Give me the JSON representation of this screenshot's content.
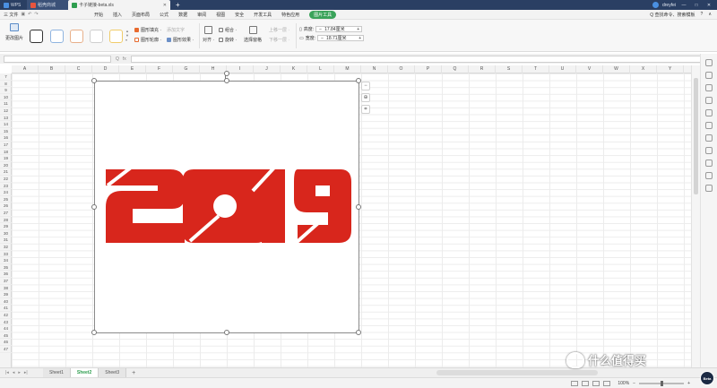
{
  "titlebar": {
    "tabs": [
      {
        "label": "WPS",
        "icon": "wps-logo-icon"
      },
      {
        "label": "稻壳商城",
        "icon": "docer-icon"
      },
      {
        "label": "卡子链接-beta.xls",
        "icon": "spreadsheet-icon",
        "active": true
      }
    ],
    "user": "dreyfei",
    "buttons": [
      "—",
      "□",
      "✕"
    ]
  },
  "menu": {
    "file_label": "三 文件",
    "items": [
      "开始",
      "插入",
      "页面布局",
      "公式",
      "数据",
      "审阅",
      "视图",
      "安全",
      "开发工具",
      "特色应用",
      "图片工具"
    ],
    "active_item": "图片工具",
    "search_label": "Q 查找命令、搜索模板"
  },
  "ribbon": {
    "change_picture": "更改图片",
    "effects": [
      "图形填充 ·",
      "图形轮廓 ·"
    ],
    "effects_right": [
      "添加文字",
      "图形效果 ·"
    ],
    "arrange_col1": [
      "对齐 ·",
      "旋转 ·"
    ],
    "arrange_col2": [
      "组合 ·",
      "选择窗格"
    ],
    "arrange_col3": [
      "上移一层 ·",
      "下移一层 ·"
    ],
    "height_label": "高度:",
    "height_value": "17.84厘米",
    "width_label": "宽度:",
    "width_value": "18.71厘米"
  },
  "formula": {
    "fx": "fx"
  },
  "grid": {
    "columns": [
      "A",
      "B",
      "C",
      "D",
      "E",
      "F",
      "G",
      "H",
      "I",
      "J",
      "K",
      "L",
      "M",
      "N",
      "O",
      "P",
      "Q",
      "R",
      "S",
      "T",
      "U",
      "V",
      "W",
      "X",
      "Y",
      "Z"
    ],
    "rows": [
      "7",
      "8",
      "9",
      "10",
      "11",
      "12",
      "13",
      "14",
      "15",
      "16",
      "17",
      "18",
      "19",
      "20",
      "21",
      "22",
      "23",
      "24",
      "25",
      "26",
      "27",
      "28",
      "29",
      "30",
      "31",
      "32",
      "33",
      "34",
      "35",
      "36",
      "37",
      "38",
      "39",
      "40",
      "41",
      "42",
      "43",
      "44",
      "45",
      "46",
      "47"
    ]
  },
  "picture": {
    "text": "2019",
    "color": "#d8261c"
  },
  "sheets": {
    "tabs": [
      "Sheet1",
      "Sheet2",
      "Sheet3"
    ],
    "active": "Sheet2",
    "add": "+"
  },
  "status": {
    "zoom": "100%",
    "zoom_fraction": 0.5,
    "beta": "Beta"
  },
  "watermark": {
    "text": "什么值得买"
  }
}
